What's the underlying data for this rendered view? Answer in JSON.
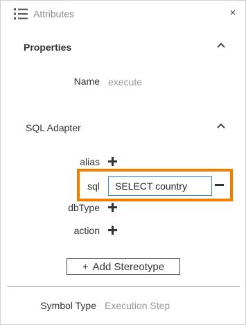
{
  "header": {
    "title": "Attributes",
    "close_glyph": "×"
  },
  "properties": {
    "title": "Properties",
    "name_label": "Name",
    "name_value": "execute"
  },
  "sql_adapter": {
    "title": "SQL Adapter",
    "alias_label": "alias",
    "sql_label": "sql",
    "sql_value": "SELECT country",
    "dbtype_label": "dbType",
    "action_label": "action"
  },
  "add_stereotype": {
    "plus": "+",
    "label": "Add Stereotype"
  },
  "symbol_type": {
    "label": "Symbol Type",
    "value": "Execution Step"
  },
  "colors": {
    "highlight": "#f07d00",
    "input_border": "#3a8fd6"
  },
  "icons": {
    "list": "list-icon",
    "close": "close-icon",
    "collapse": "chevron-up-icon",
    "add": "plus-icon",
    "remove": "minus-icon"
  }
}
